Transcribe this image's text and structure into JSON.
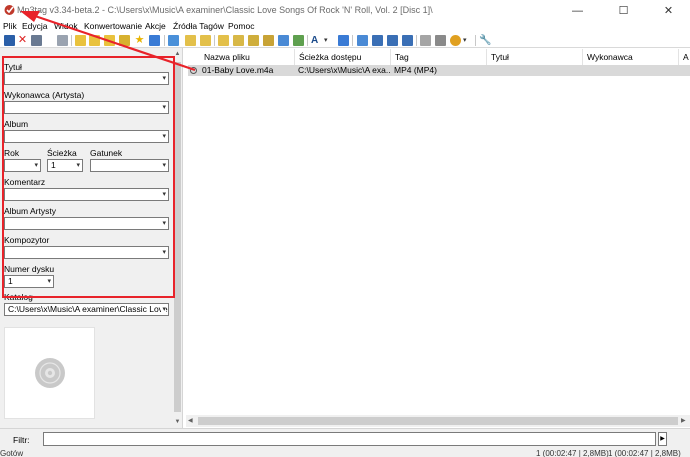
{
  "window": {
    "title": "Mp3tag v3.34-beta.2  -  C:\\Users\\x\\Music\\A examiner\\Classic Love Songs Of Rock 'N' Roll, Vol. 2 [Disc 1]\\"
  },
  "menu": {
    "items": [
      "Plik",
      "Edycja",
      "Widok",
      "Konwertowanie",
      "Akcje",
      "Źródła Tagów",
      "Pomoc"
    ]
  },
  "tag_panel": {
    "fields": {
      "title_label": "Tytuł",
      "artist_label": "Wykonawca (Artysta)",
      "album_label": "Album",
      "year_label": "Rok",
      "track_label": "Ścieżka",
      "track_value": "1",
      "genre_label": "Gatunek",
      "comment_label": "Komentarz",
      "album_artist_label": "Album Artysty",
      "composer_label": "Kompozytor",
      "disc_label": "Numer dysku",
      "disc_value": "1",
      "directory_label": "Katalog",
      "directory_value": "C:\\Users\\x\\Music\\A examiner\\Classic Love So"
    }
  },
  "file_list": {
    "columns": [
      "Nazwa pliku",
      "Ścieżka dostępu",
      "Tag",
      "Tytuł",
      "Wykonawca",
      "A"
    ],
    "rows": [
      {
        "filename": "01-Baby Love.m4a",
        "path": "C:\\Users\\x\\Music\\A exa...",
        "tag": "MP4 (MP4)",
        "title": "",
        "artist": ""
      }
    ]
  },
  "filter": {
    "label": "Filtr:",
    "value": ""
  },
  "status": {
    "left": "Gotów",
    "mid": "1 (00:02:47 | 2,8MB)",
    "right": "1 (00:02:47 | 2,8MB)"
  },
  "colors": {
    "annotation": "#e8232a",
    "selected_row": "#d9d9d9",
    "panel_bg": "#f0f0f0"
  }
}
